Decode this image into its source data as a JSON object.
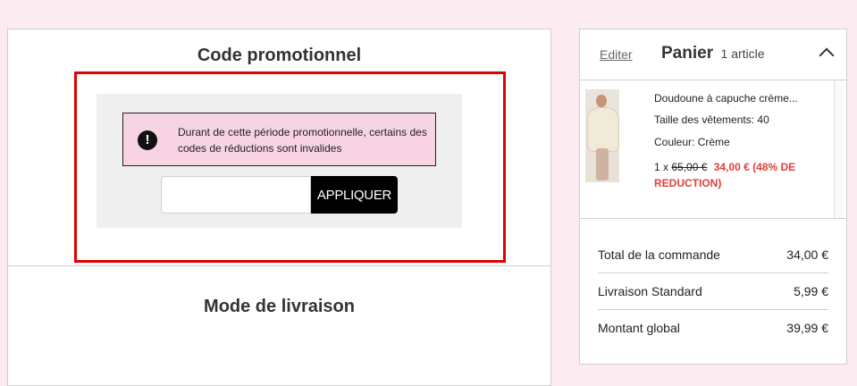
{
  "promo": {
    "title": "Code promotionnel",
    "alert_message": "Durant de cette période promotionnelle, certains des codes de réductions sont invalides",
    "input_value": "",
    "apply_label": "APPLIQUER",
    "alert_icon": "exclamation-icon"
  },
  "delivery": {
    "title": "Mode de livraison"
  },
  "cart": {
    "edit_label": "Editer",
    "title": "Panier",
    "count": "1 article",
    "item": {
      "name": "Doudoune à capuche crème...",
      "size": "Taille des vêtements: 40",
      "color": "Couleur: Crème",
      "quantity_prefix": "1 x",
      "old_price": "65,00 €",
      "new_price": "34,00 € (48% DE REDUCTION)"
    },
    "summary": [
      {
        "label": "Total de la commande",
        "value": "34,00 €"
      },
      {
        "label": "Livraison Standard",
        "value": "5,99 €"
      },
      {
        "label": "Montant global",
        "value": "39,99 €"
      }
    ]
  },
  "colors": {
    "page_bg": "#fcecf2",
    "alert_bg": "#f7d3e3",
    "highlight_border": "#e00000",
    "discount_red": "#e0413a",
    "button_bg": "#000000"
  }
}
